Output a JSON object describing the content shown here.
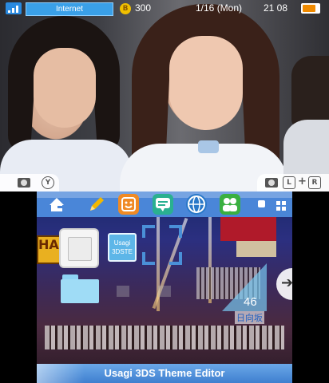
{
  "status_bar": {
    "network_label": "Internet",
    "coin_count": "300",
    "coin_symbol": "B",
    "date": "1/16 (Mon)",
    "time": "21 08",
    "battery_level": 0.8
  },
  "top_buttons": {
    "screenshot_button": "Y",
    "shoulder_left": "L",
    "shoulder_right": "R",
    "plus": "+"
  },
  "theme": {
    "title": "Usagi 3DS Theme Editor",
    "usagi_tile_label": "Usagi 3DSTE",
    "pennant_number": "46",
    "pennant_text": "日向坂",
    "marquee_text": "HAP",
    "strip_color": "#4a86d8",
    "bar_color": "#3f7fcf"
  },
  "toolbar": {
    "apps": [
      {
        "name": "home-settings-icon",
        "color": "#4a86d8"
      },
      {
        "name": "pencil-icon",
        "color": "#f2b800"
      },
      {
        "name": "face-icon",
        "color": "#f08a24"
      },
      {
        "name": "chat-icon",
        "color": "#2ab090"
      },
      {
        "name": "globe-icon",
        "color": "#2a78c8"
      },
      {
        "name": "friends-icon",
        "color": "#3ab040"
      }
    ]
  }
}
